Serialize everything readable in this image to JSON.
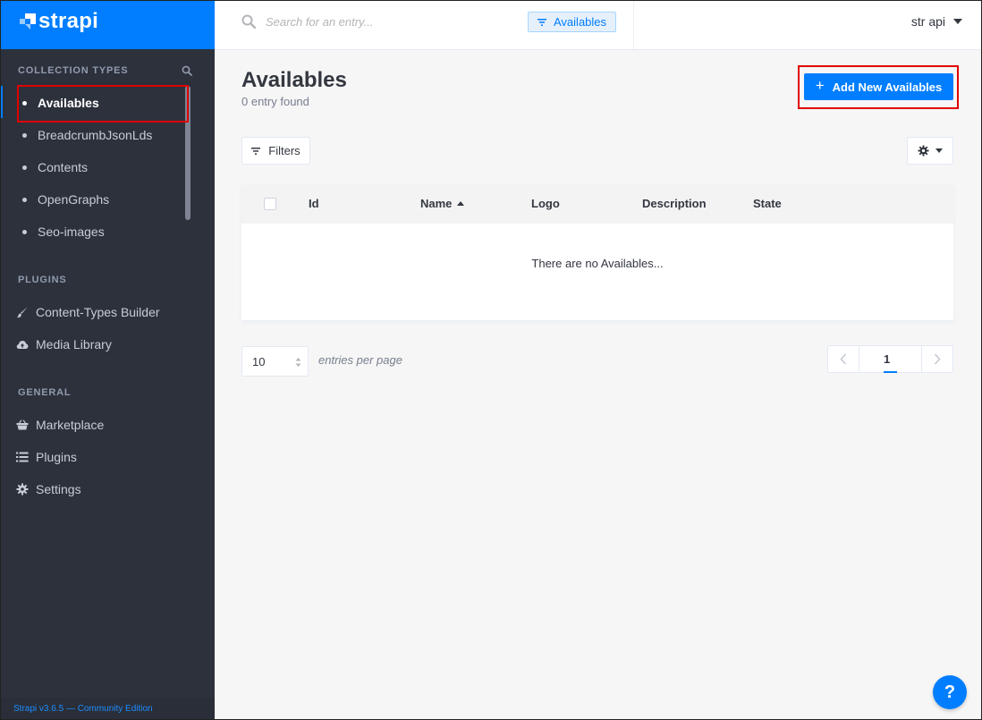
{
  "brand": {
    "name": "strapi"
  },
  "sidebar": {
    "collection_types_title": "COLLECTION TYPES",
    "collection_types": [
      {
        "label": "Availables",
        "active": true
      },
      {
        "label": "BreadcrumbJsonLds"
      },
      {
        "label": "Contents"
      },
      {
        "label": "OpenGraphs"
      },
      {
        "label": "Seo-images"
      }
    ],
    "plugins_title": "PLUGINS",
    "plugins": [
      {
        "label": "Content-Types Builder",
        "icon": "paintbrush-icon"
      },
      {
        "label": "Media Library",
        "icon": "cloud-upload-icon"
      }
    ],
    "general_title": "GENERAL",
    "general": [
      {
        "label": "Marketplace",
        "icon": "basket-icon"
      },
      {
        "label": "Plugins",
        "icon": "list-icon"
      },
      {
        "label": "Settings",
        "icon": "gear-icon"
      }
    ],
    "footer": "Strapi v3.6.5 — Community Edition"
  },
  "header": {
    "search_placeholder": "Search for an entry...",
    "filter_chip": "Availables",
    "user": "str api"
  },
  "main": {
    "title": "Availables",
    "subtitle": "0 entry found",
    "add_button": "Add New Availables",
    "filters_button": "Filters",
    "table": {
      "columns": [
        "Id",
        "Name",
        "Logo",
        "Description",
        "State"
      ],
      "sorted_column": "Name",
      "empty_message": "There are no Availables..."
    },
    "pagination": {
      "per_page": "10",
      "per_page_label": "entries per page",
      "current_page": "1"
    }
  },
  "help": {
    "label": "?"
  },
  "colors": {
    "accent": "#007eff",
    "sidebar": "#2e3340",
    "highlight": "#e00000"
  }
}
